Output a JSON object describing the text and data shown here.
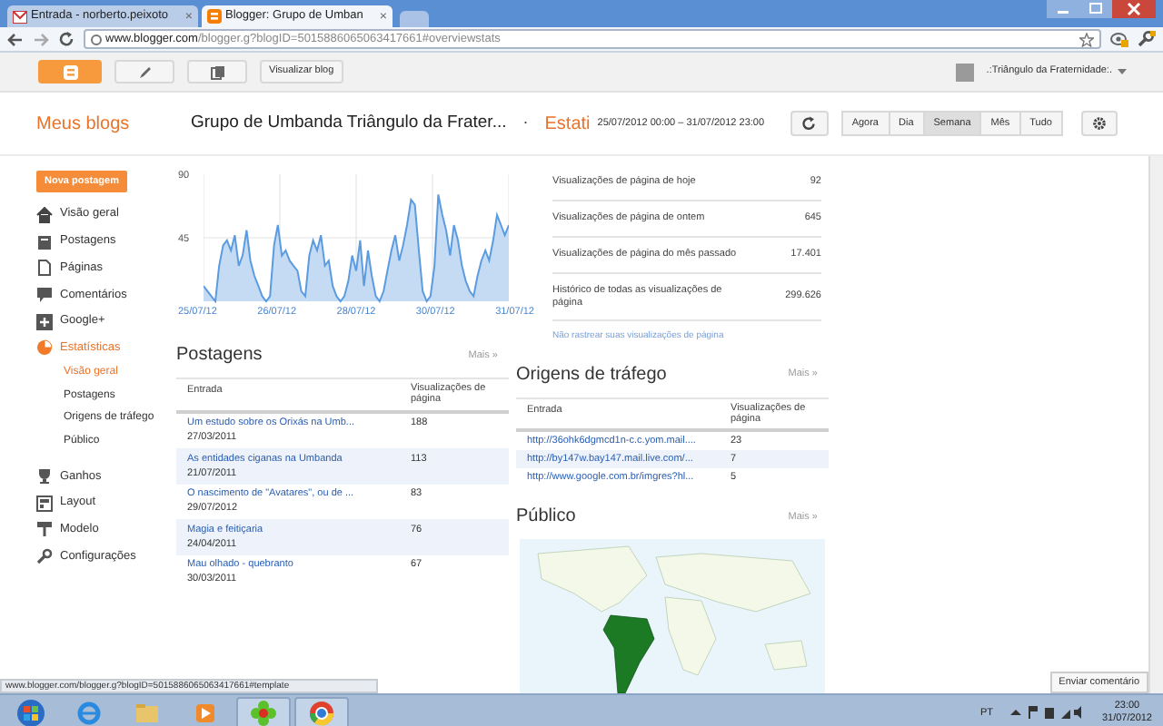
{
  "browser": {
    "tabs": [
      {
        "title": "Entrada - norberto.peixoto",
        "selected": false
      },
      {
        "title": "Blogger: Grupo de Umban",
        "selected": true
      }
    ],
    "close_glyph": "×",
    "url_host": "www.blogger.com",
    "url_rest": "/blogger.g?blogID=5015886065063417661#overviewstats"
  },
  "topbar": {
    "view_blog": "Visualizar blog",
    "account": ".:Triângulo da Fraternidade:."
  },
  "header": {
    "my_blogs": "Meus blogs",
    "blog_title": "Grupo de Umbanda Triângulo da Frater...",
    "separator": "·",
    "section": "Estati",
    "date_range": "25/07/2012 00:00 – 31/07/2012 23:00",
    "ranges": [
      {
        "label": "Agora",
        "selected": false
      },
      {
        "label": "Dia",
        "selected": false
      },
      {
        "label": "Semana",
        "selected": true
      },
      {
        "label": "Mês",
        "selected": false
      },
      {
        "label": "Tudo",
        "selected": false
      }
    ]
  },
  "sidebar": {
    "new_post": "Nova postagem",
    "items": [
      {
        "label": "Visão geral",
        "selected": false
      },
      {
        "label": "Postagens",
        "selected": false
      },
      {
        "label": "Páginas",
        "selected": false
      },
      {
        "label": "Comentários",
        "selected": false
      },
      {
        "label": "Google+",
        "selected": false
      },
      {
        "label": "Estatísticas",
        "selected": true,
        "children": [
          {
            "label": "Visão geral",
            "selected": true
          },
          {
            "label": "Postagens",
            "selected": false
          },
          {
            "label": "Origens de tráfego",
            "selected": false
          },
          {
            "label": "Público",
            "selected": false
          }
        ]
      },
      {
        "label": "Ganhos",
        "selected": false
      },
      {
        "label": "Layout",
        "selected": false
      },
      {
        "label": "Modelo",
        "selected": false
      },
      {
        "label": "Configurações",
        "selected": false
      }
    ]
  },
  "chart": {
    "y_labels": [
      "90",
      "45"
    ],
    "x_labels": [
      "25/07/12",
      "26/07/12",
      "28/07/12",
      "30/07/12",
      "31/07/12"
    ]
  },
  "summary": [
    {
      "label": "Visualizações de página de hoje",
      "value": "92"
    },
    {
      "label": "Visualizações de página de ontem",
      "value": "645"
    },
    {
      "label": "Visualizações de página do mês passado",
      "value": "17.401"
    },
    {
      "label": "Histórico de todas as visualizações de página",
      "value": "299.626"
    }
  ],
  "no_track_link": "Não rastrear suas visualizações de página",
  "posts": {
    "title": "Postagens",
    "more": "Mais »",
    "columns": [
      "Entrada",
      "Visualizações de página"
    ],
    "rows": [
      {
        "title": "Um estudo sobre os Orixás na Umb...",
        "date": "27/03/2011",
        "views": "188"
      },
      {
        "title": "As entidades ciganas na Umbanda",
        "date": "21/07/2011",
        "views": "113"
      },
      {
        "title": "O nascimento de \"Avatares\", ou de ...",
        "date": "29/07/2012",
        "views": "83"
      },
      {
        "title": "Magia e feitiçaria",
        "date": "24/04/2011",
        "views": "76"
      },
      {
        "title": "Mau olhado - quebranto",
        "date": "30/03/2011",
        "views": "67"
      }
    ]
  },
  "traffic": {
    "title": "Origens de tráfego",
    "more": "Mais »",
    "columns": [
      "Entrada",
      "Visualizações de página"
    ],
    "rows": [
      {
        "url": "http://36ohk6dgmcd1n-c.c.yom.mail....",
        "views": "23"
      },
      {
        "url": "http://by147w.bay147.mail.live.com/...",
        "views": "7"
      },
      {
        "url": "http://www.google.com.br/imgres?hl...",
        "views": "5"
      }
    ]
  },
  "audience": {
    "title": "Público",
    "more": "Mais »"
  },
  "status_url": "www.blogger.com/blogger.g?blogID=5015886065063417661#template",
  "feedback": "Enviar comentário",
  "taskbar": {
    "apps": [
      {
        "active": false
      },
      {
        "active": false
      },
      {
        "active": false
      },
      {
        "active": false
      },
      {
        "active": true
      },
      {
        "active": true
      }
    ],
    "lang": "PT",
    "time": "23:00",
    "date": "31/07/2012"
  }
}
